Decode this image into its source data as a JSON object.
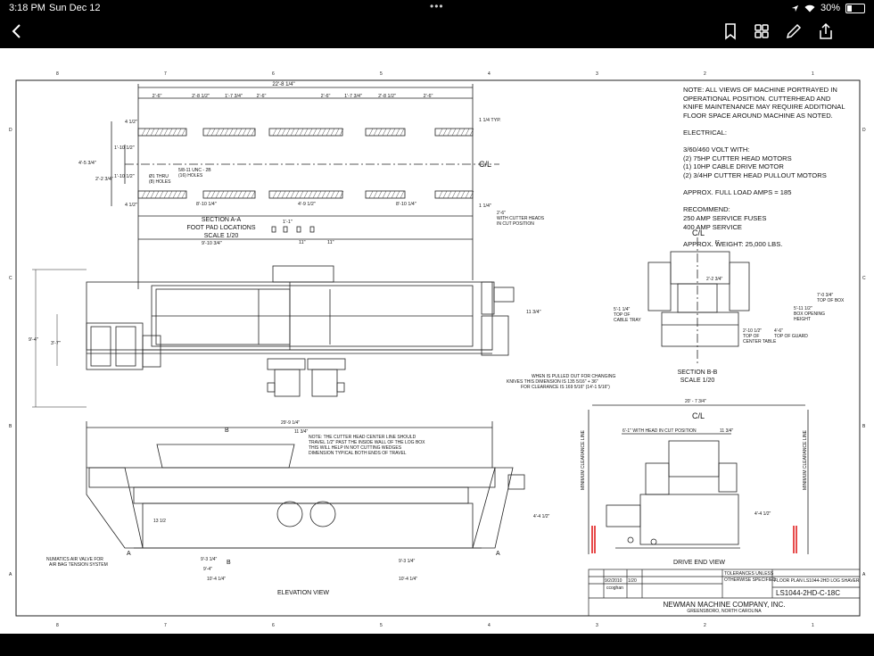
{
  "status_bar": {
    "time": "3:18 PM",
    "date": "Sun Dec 12",
    "battery": "30%",
    "battery_level": 0.3
  },
  "toolbar": {
    "back": "back-icon",
    "bookmark": "bookmark-icon",
    "grid": "grid-icon",
    "markup": "pencil-icon",
    "share": "share-icon"
  },
  "drawing": {
    "notes": "NOTE:  ALL VIEWS OF MACHINE PORTRAYED IN\nOPERATIONAL POSITION.  CUTTERHEAD AND\nKNIFE MAINTENANCE MAY REQUIRE ADDITIONAL\nFLOOR SPACE AROUND MACHINE AS NOTED.\n\nELECTRICAL:\n\n3/60/460 VOLT WITH:\n(2) 75HP CUTTER HEAD MOTORS\n(1) 10HP CABLE DRIVE MOTOR\n(2)  3/4HP CUTTER HEAD PULLOUT MOTORS\n\n      APPROX.  FULL LOAD AMPS = 185\n\nRECOMMEND:\n250 AMP SERVICE FUSES\n400 AMP SERVICE\n\n      APPROX.  WEIGHT: 25,000 LBS.",
    "section_aa": {
      "title": "SECTION  A-A",
      "sub": "FOOT PAD LOCATIONS",
      "scale": "SCALE 1/20"
    },
    "section_bb": {
      "title": "SECTION  B-B",
      "scale": "SCALE 1/20"
    },
    "elevation_view": "ELEVATION VIEW",
    "drive_end_view": "DRIVE END VIEW",
    "centerline": "C/L",
    "cl_bb": "C/L",
    "cl_drive": "C/L",
    "dims": {
      "overall_top": "22'-8 1/4\"",
      "seg1": "2'-6\"",
      "seg2": "2'-8 1/2\"",
      "seg3": "1'-7 3/4\"",
      "seg4": "2'-6\"",
      "seg5": "2'-6\"",
      "seg6": "1'-7 3/4\"",
      "seg7": "2'-8 1/2\"",
      "seg8": "2'-6\"",
      "pad_w1": "4 1/2\"",
      "pad_w2": "4 1/2\"",
      "h_1_10": "1'-10 1/2\"",
      "h_4_5": "4'-5 3/4\"",
      "h_2_2": "2'-2 3/4\"",
      "h_1_10b": "1'-10 1/2\"",
      "thru": "Ø1 THRU\n(8) HOLES",
      "unc": "5/8-11 UNC - 2B\n(16) HOLES",
      "typ": "1 1/4 TYP.",
      "d8_10a": "8'-10 1/4\"",
      "d4_9": "4'-9 1/2\"",
      "d8_10b": "8'-10 1/4\"",
      "d1_1": "1 1/4\"",
      "d2_6": "2'-6\"\nWITH CUTTER HEADS\nIN CUT POSITION",
      "d1_1b": "1'-1\"",
      "d11a": "11\"",
      "d11b": "11\"",
      "d9_10": "9'-10 3/4\"",
      "d9_4": "9'-4\"",
      "d3_7": "3'-7\"",
      "d11_3": "11 3/4\"",
      "d5": "5\"",
      "d2_2": "2'-2 3/4\"",
      "d5_1": "5'-1 1/4\"\nTOP OF\nCABLE TRAY",
      "d7_0": "7'-0 3/4\"\nTOP OF BOX",
      "d5_11": "5'-11 1/2\"\nBOX OPENING\nHEIGHT",
      "d2_10": "2'-10 1/2\"\nTOP OF\nCENTER TABLE",
      "d4_6": "4'-6\"\nTOP OF GUARD",
      "pulled_note": "WHEN IS PULLED OUT FOR CHANGING\nKNIVES THIS DIMENSION IS 135 5/16\" + 36\"\nFOR CLEARANCE IS 169 5/16\" (14'-1 5/16\")",
      "d20_7": "20' - 7 3/4\"",
      "d6_1": "6'-1\" WITH HEAD IN CUT POSITION",
      "d11_3b": "11 3/4\"",
      "d29_9": "29'-9 1/4\"",
      "d11_3c": "11 3/4\"",
      "cut_note": "NOTE:  THE CUTTER HEAD CENTER LINE SHOULD\nTRAVEL 1/2\"  PAST THE INSIDE WALL OF THE LOG BOX\nTHIS WILL HELP IN NOT CUTTING WEDGES\nDIMENSION TYPICAL BOTH ENDS OF TRAVEL",
      "d13": "13 1/2",
      "d4_4": "4'-4 1/2\"",
      "d4_4b": "4'-4 1/2\"",
      "air_note": "NUMATICS AIR VALVE FOR\nAIR BAG TENSION SYSTEM",
      "d9_3a": "9'-3 1/4\"",
      "d9_4b": "9'-4\"",
      "d10_4a": "10'-4 1/4\"",
      "d9_3b": "9'-3 1/4\"",
      "d10_4b": "10'-4 1/4\"",
      "min_clear": "MINIMUM CLEARANCE LINE",
      "sec_a": "A",
      "sec_b": "B",
      "sec_a2": "A",
      "sec_b2": "B"
    },
    "title_block": {
      "date": "9/2/2010",
      "drawn": "ccoghan",
      "scale": "1/20",
      "tolerances": "TOLERANCES UNLESS\nOTHERWISE SPECIFIED",
      "title": "FLOOR PLAN LS1044-2HD LOG SHAVER",
      "number": "LS1044-2HD-C-18C",
      "company": "NEWMAN MACHINE COMPANY, INC.",
      "city": "GREENSBORO, NORTH CAROLINA"
    },
    "border_letters": [
      "D",
      "C",
      "B",
      "A"
    ],
    "border_numbers": [
      "8",
      "7",
      "6",
      "5",
      "4",
      "3",
      "2",
      "1"
    ]
  }
}
